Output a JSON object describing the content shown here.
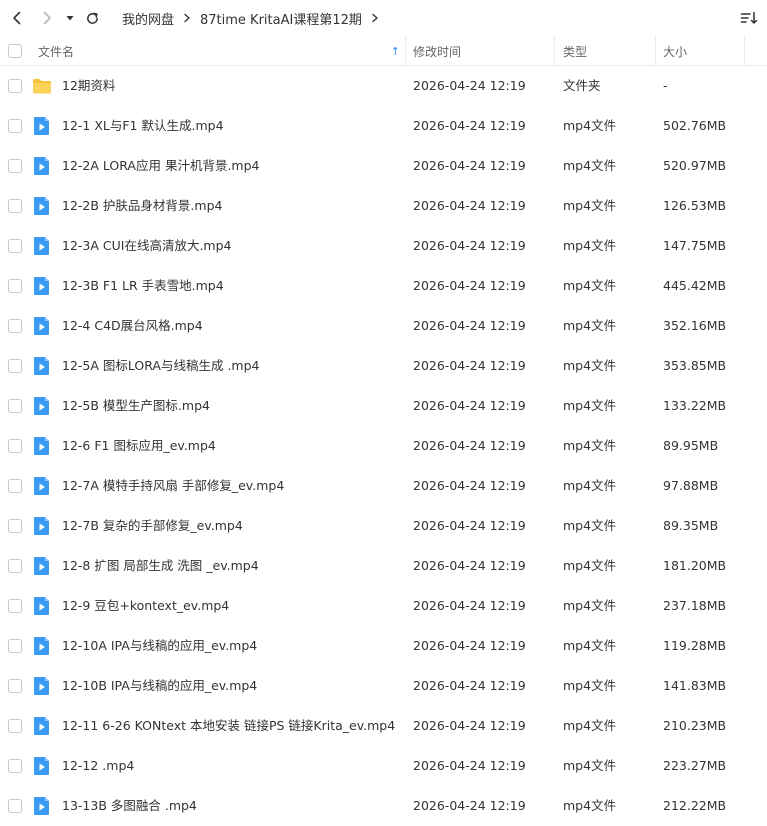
{
  "toolbar": {
    "back_icon": "chevron-left-icon",
    "forward_icon": "chevron-right-icon",
    "history_icon": "caret-down-icon",
    "refresh_icon": "refresh-icon",
    "sort_icon": "sort-list-icon"
  },
  "breadcrumb": {
    "items": [
      "我的网盘",
      "87time KritaAI课程第12期"
    ]
  },
  "columns": {
    "name": "文件名",
    "modified": "修改时间",
    "type": "类型",
    "size": "大小",
    "sort_indicator": "↑"
  },
  "colors": {
    "accent": "#2d8cf0",
    "folder": "#f9c23c",
    "video": "#3a9bf4"
  },
  "files": [
    {
      "name": "12期资料",
      "modified": "2026-04-24 12:19",
      "type": "文件夹",
      "size": "-",
      "kind": "folder"
    },
    {
      "name": "12-1 XL与F1 默认生成.mp4",
      "modified": "2026-04-24 12:19",
      "type": "mp4文件",
      "size": "502.76MB",
      "kind": "video"
    },
    {
      "name": "12-2A LORA应用 果汁机背景.mp4",
      "modified": "2026-04-24 12:19",
      "type": "mp4文件",
      "size": "520.97MB",
      "kind": "video"
    },
    {
      "name": "12-2B 护肤品身材背景.mp4",
      "modified": "2026-04-24 12:19",
      "type": "mp4文件",
      "size": "126.53MB",
      "kind": "video"
    },
    {
      "name": "12-3A CUI在线高清放大.mp4",
      "modified": "2026-04-24 12:19",
      "type": "mp4文件",
      "size": "147.75MB",
      "kind": "video"
    },
    {
      "name": "12-3B F1 LR 手表雪地.mp4",
      "modified": "2026-04-24 12:19",
      "type": "mp4文件",
      "size": "445.42MB",
      "kind": "video"
    },
    {
      "name": "12-4 C4D展台风格.mp4",
      "modified": "2026-04-24 12:19",
      "type": "mp4文件",
      "size": "352.16MB",
      "kind": "video"
    },
    {
      "name": "12-5A 图标LORA与线稿生成 .mp4",
      "modified": "2026-04-24 12:19",
      "type": "mp4文件",
      "size": "353.85MB",
      "kind": "video"
    },
    {
      "name": "12-5B 模型生产图标.mp4",
      "modified": "2026-04-24 12:19",
      "type": "mp4文件",
      "size": "133.22MB",
      "kind": "video"
    },
    {
      "name": "12-6 F1 图标应用_ev.mp4",
      "modified": "2026-04-24 12:19",
      "type": "mp4文件",
      "size": "89.95MB",
      "kind": "video"
    },
    {
      "name": "12-7A 模特手持风扇 手部修复_ev.mp4",
      "modified": "2026-04-24 12:19",
      "type": "mp4文件",
      "size": "97.88MB",
      "kind": "video"
    },
    {
      "name": "12-7B 复杂的手部修复_ev.mp4",
      "modified": "2026-04-24 12:19",
      "type": "mp4文件",
      "size": "89.35MB",
      "kind": "video"
    },
    {
      "name": "12-8 扩图 局部生成 洗图 _ev.mp4",
      "modified": "2026-04-24 12:19",
      "type": "mp4文件",
      "size": "181.20MB",
      "kind": "video"
    },
    {
      "name": "12-9 豆包+kontext_ev.mp4",
      "modified": "2026-04-24 12:19",
      "type": "mp4文件",
      "size": "237.18MB",
      "kind": "video"
    },
    {
      "name": "12-10A IPA与线稿的应用_ev.mp4",
      "modified": "2026-04-24 12:19",
      "type": "mp4文件",
      "size": "119.28MB",
      "kind": "video"
    },
    {
      "name": "12-10B IPA与线稿的应用_ev.mp4",
      "modified": "2026-04-24 12:19",
      "type": "mp4文件",
      "size": "141.83MB",
      "kind": "video"
    },
    {
      "name": "12-11 6-26 KONtext 本地安装 链接PS 链接Krita_ev.mp4",
      "modified": "2026-04-24 12:19",
      "type": "mp4文件",
      "size": "210.23MB",
      "kind": "video"
    },
    {
      "name": "12-12 .mp4",
      "modified": "2026-04-24 12:19",
      "type": "mp4文件",
      "size": "223.27MB",
      "kind": "video"
    },
    {
      "name": "13-13B 多图融合 .mp4",
      "modified": "2026-04-24 12:19",
      "type": "mp4文件",
      "size": "212.22MB",
      "kind": "video"
    }
  ]
}
